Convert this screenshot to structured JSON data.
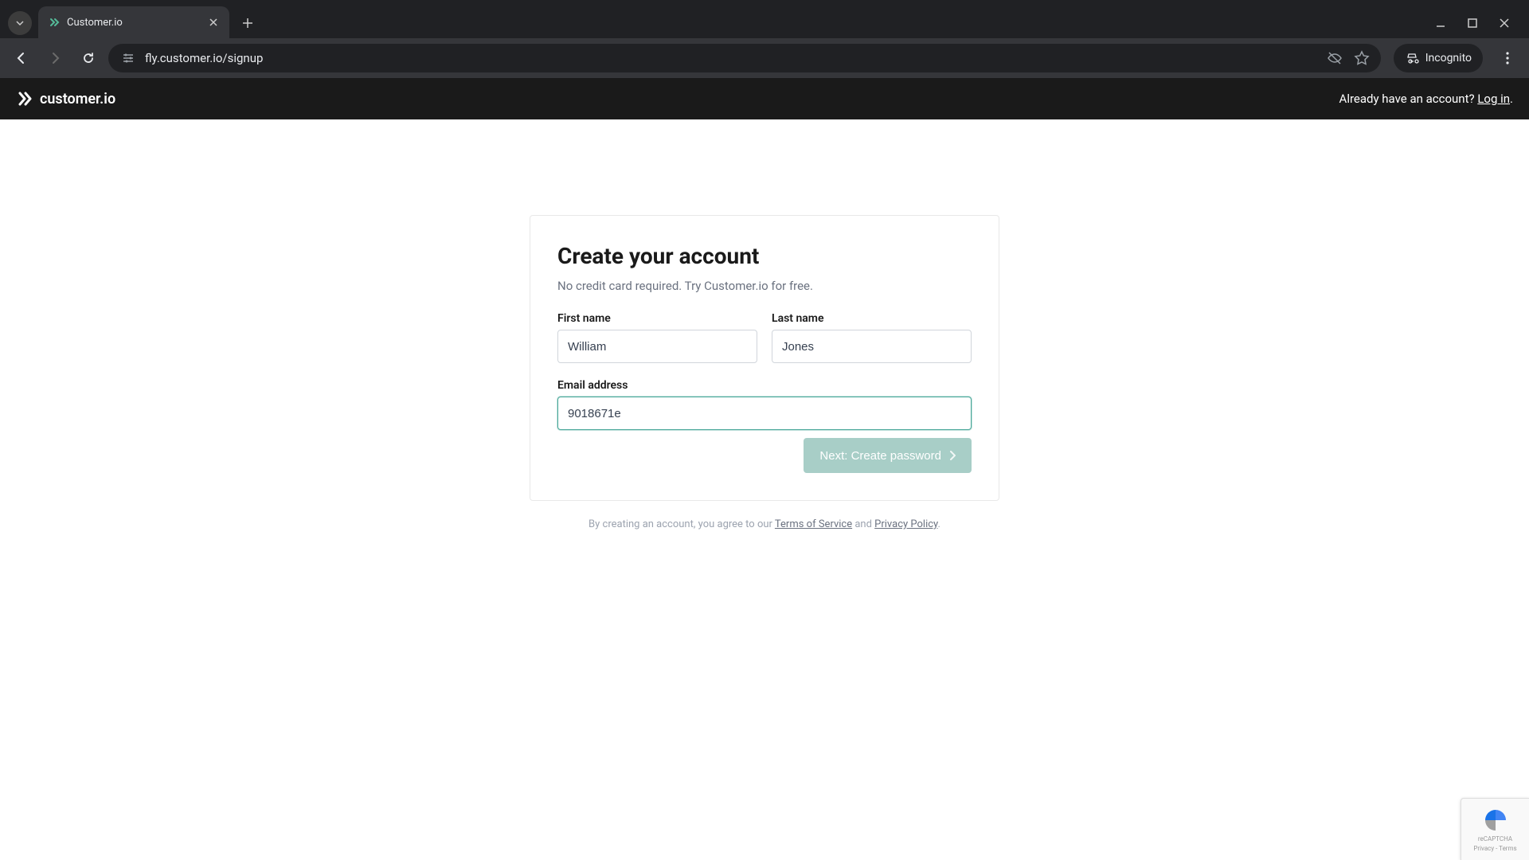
{
  "browser": {
    "tab_title": "Customer.io",
    "url": "fly.customer.io/signup",
    "incognito_label": "Incognito"
  },
  "header": {
    "brand": "customer.io",
    "prompt": "Already have an account? ",
    "login_link": "Log in"
  },
  "form": {
    "title": "Create your account",
    "subtitle": "No credit card required. Try Customer.io for free.",
    "first_name_label": "First name",
    "first_name_value": "William",
    "last_name_label": "Last name",
    "last_name_value": "Jones",
    "email_label": "Email address",
    "email_value": "9018671e",
    "next_button": "Next: Create password"
  },
  "legal": {
    "prefix": "By creating an account, you agree to our ",
    "terms": "Terms of Service",
    "and": " and ",
    "privacy": "Privacy Policy",
    "suffix": "."
  },
  "recaptcha": {
    "line1": "reCAPTCHA",
    "line2": "Privacy - Terms"
  }
}
